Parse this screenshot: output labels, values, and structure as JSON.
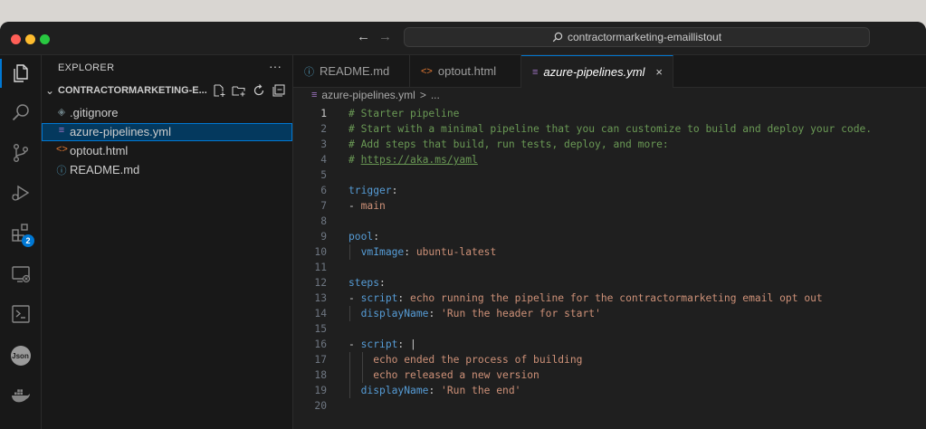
{
  "titlebar": {
    "back_arrow": "←",
    "forward_arrow": "→",
    "search_text": "contractormarketing-emaillistout",
    "traffic_lights": [
      "#ff5f57",
      "#febc2e",
      "#28c840"
    ]
  },
  "activity_bar": {
    "items": [
      {
        "name": "explorer-icon",
        "active": true
      },
      {
        "name": "search-icon"
      },
      {
        "name": "source-control-icon"
      },
      {
        "name": "run-debug-icon"
      },
      {
        "name": "extensions-icon",
        "badge": "2"
      },
      {
        "name": "remote-explorer-icon"
      },
      {
        "name": "terminal-icon"
      },
      {
        "name": "json-icon",
        "label": "Json"
      },
      {
        "name": "docker-icon"
      }
    ]
  },
  "sidebar": {
    "title": "EXPLORER",
    "more": "···",
    "folder": "CONTRACTORMARKETING-E...",
    "files": [
      {
        "name": ".gitignore",
        "icon": "◈",
        "icon_name": "git-file-icon",
        "icon_color": "#6d8086",
        "selected": false
      },
      {
        "name": "azure-pipelines.yml",
        "icon": "≡",
        "icon_name": "yaml-file-icon",
        "icon_color": "#a074c4",
        "selected": true
      },
      {
        "name": "optout.html",
        "icon": "<>",
        "icon_name": "html-file-icon",
        "icon_color": "#e37933",
        "selected": false
      },
      {
        "name": "README.md",
        "icon": "ⓘ",
        "icon_name": "markdown-info-icon",
        "icon_color": "#519aba",
        "selected": false
      }
    ]
  },
  "tabs": [
    {
      "label": "README.md",
      "icon": "ⓘ",
      "icon_name": "info-icon",
      "icon_color": "#519aba",
      "active": false
    },
    {
      "label": "optout.html",
      "icon": "<>",
      "icon_name": "html-icon",
      "icon_color": "#e37933",
      "active": false
    },
    {
      "label": "azure-pipelines.yml",
      "icon": "≡",
      "icon_name": "yaml-icon",
      "icon_color": "#a074c4",
      "active": true,
      "close": "×"
    }
  ],
  "breadcrumb": {
    "file": "azure-pipelines.yml",
    "sep": ">",
    "rest": "..."
  },
  "editor": {
    "current_line": 1,
    "lines": [
      {
        "n": "1",
        "g": 0,
        "tokens": [
          [
            "c-com",
            "# Starter pipeline"
          ]
        ]
      },
      {
        "n": "2",
        "g": 0,
        "tokens": [
          [
            "c-com",
            "# Start with a minimal pipeline that you can customize to build and deploy your code."
          ]
        ]
      },
      {
        "n": "3",
        "g": 0,
        "tokens": [
          [
            "c-com",
            "# Add steps that build, run tests, deploy, and more:"
          ]
        ]
      },
      {
        "n": "4",
        "g": 0,
        "tokens": [
          [
            "c-com",
            "# "
          ],
          [
            "c-link",
            "https://aka.ms/yaml"
          ]
        ]
      },
      {
        "n": "5",
        "g": 0,
        "tokens": []
      },
      {
        "n": "6",
        "g": 0,
        "tokens": [
          [
            "c-key",
            "trigger"
          ],
          [
            "c-plain",
            ":"
          ]
        ]
      },
      {
        "n": "7",
        "g": 0,
        "tokens": [
          [
            "c-plain",
            "- "
          ],
          [
            "c-str",
            "main"
          ]
        ]
      },
      {
        "n": "8",
        "g": 0,
        "tokens": []
      },
      {
        "n": "9",
        "g": 0,
        "tokens": [
          [
            "c-key",
            "pool"
          ],
          [
            "c-plain",
            ":"
          ]
        ]
      },
      {
        "n": "10",
        "g": 1,
        "tokens": [
          [
            "c-plain",
            "  "
          ],
          [
            "c-key",
            "vmImage"
          ],
          [
            "c-plain",
            ": "
          ],
          [
            "c-str",
            "ubuntu-latest"
          ]
        ]
      },
      {
        "n": "11",
        "g": 0,
        "tokens": []
      },
      {
        "n": "12",
        "g": 0,
        "tokens": [
          [
            "c-key",
            "steps"
          ],
          [
            "c-plain",
            ":"
          ]
        ]
      },
      {
        "n": "13",
        "g": 0,
        "tokens": [
          [
            "c-plain",
            "- "
          ],
          [
            "c-key",
            "script"
          ],
          [
            "c-plain",
            ": "
          ],
          [
            "c-str",
            "echo running the pipeline for the contractormarketing email opt out"
          ]
        ]
      },
      {
        "n": "14",
        "g": 1,
        "tokens": [
          [
            "c-plain",
            "  "
          ],
          [
            "c-key",
            "displayName"
          ],
          [
            "c-plain",
            ": "
          ],
          [
            "c-str",
            "'Run the header for start'"
          ]
        ]
      },
      {
        "n": "15",
        "g": 0,
        "tokens": []
      },
      {
        "n": "16",
        "g": 0,
        "tokens": [
          [
            "c-plain",
            "- "
          ],
          [
            "c-key",
            "script"
          ],
          [
            "c-plain",
            ": "
          ],
          [
            "c-plain",
            "|"
          ]
        ]
      },
      {
        "n": "17",
        "g": 2,
        "tokens": [
          [
            "c-plain",
            "    "
          ],
          [
            "c-str",
            "echo ended the process of building"
          ]
        ]
      },
      {
        "n": "18",
        "g": 2,
        "tokens": [
          [
            "c-plain",
            "    "
          ],
          [
            "c-str",
            "echo released a new version"
          ]
        ]
      },
      {
        "n": "19",
        "g": 1,
        "tokens": [
          [
            "c-plain",
            "  "
          ],
          [
            "c-key",
            "displayName"
          ],
          [
            "c-plain",
            ": "
          ],
          [
            "c-str",
            "'Run the end'"
          ]
        ]
      },
      {
        "n": "20",
        "g": 0,
        "tokens": []
      }
    ]
  }
}
